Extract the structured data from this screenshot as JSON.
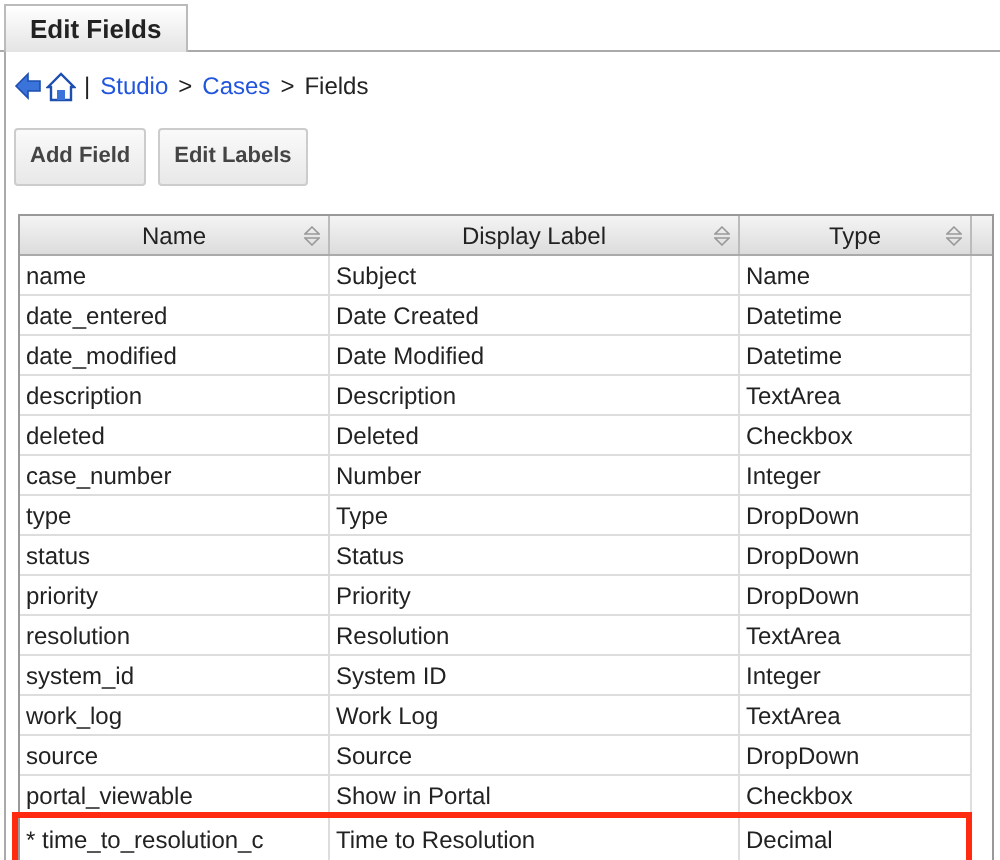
{
  "tab": {
    "label": "Edit Fields",
    "selected": true
  },
  "breadcrumb": {
    "separator": "|",
    "links": [
      "Studio",
      "Cases"
    ],
    "arrows": [
      ">",
      ">"
    ],
    "current": "Fields"
  },
  "buttons": [
    "Add Field",
    "Edit Labels"
  ],
  "table": {
    "columns": [
      "Name",
      "Display Label",
      "Type"
    ],
    "rows": [
      {
        "cells": [
          "name",
          "Subject",
          "Name"
        ],
        "highlighted": false
      },
      {
        "cells": [
          "date_entered",
          "Date Created",
          "Datetime"
        ],
        "highlighted": false
      },
      {
        "cells": [
          "date_modified",
          "Date Modified",
          "Datetime"
        ],
        "highlighted": false
      },
      {
        "cells": [
          "description",
          "Description",
          "TextArea"
        ],
        "highlighted": false
      },
      {
        "cells": [
          "deleted",
          "Deleted",
          "Checkbox"
        ],
        "highlighted": false
      },
      {
        "cells": [
          "case_number",
          "Number",
          "Integer"
        ],
        "highlighted": false
      },
      {
        "cells": [
          "type",
          "Type",
          "DropDown"
        ],
        "highlighted": false
      },
      {
        "cells": [
          "status",
          "Status",
          "DropDown"
        ],
        "highlighted": false
      },
      {
        "cells": [
          "priority",
          "Priority",
          "DropDown"
        ],
        "highlighted": false
      },
      {
        "cells": [
          "resolution",
          "Resolution",
          "TextArea"
        ],
        "highlighted": false
      },
      {
        "cells": [
          "system_id",
          "System ID",
          "Integer"
        ],
        "highlighted": false
      },
      {
        "cells": [
          "work_log",
          "Work Log",
          "TextArea"
        ],
        "highlighted": false
      },
      {
        "cells": [
          "source",
          "Source",
          "DropDown"
        ],
        "highlighted": false
      },
      {
        "cells": [
          "portal_viewable",
          "Show in Portal",
          "Checkbox"
        ],
        "highlighted": false
      },
      {
        "cells": [
          "* time_to_resolution_c",
          "Time to Resolution",
          "Decimal"
        ],
        "highlighted": true
      }
    ]
  }
}
